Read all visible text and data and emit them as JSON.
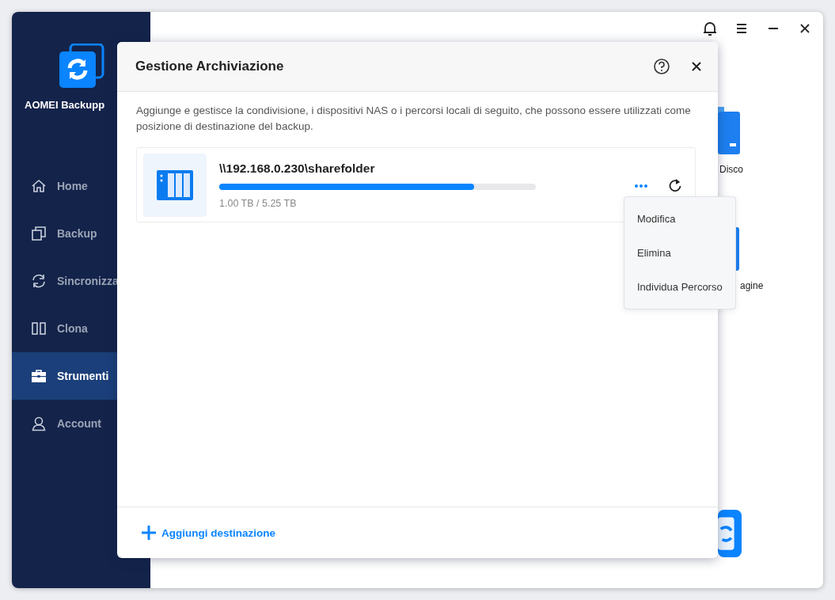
{
  "app": {
    "name": "AOMEI Backupp"
  },
  "sidebar": {
    "items": [
      {
        "label": "Home",
        "selected": false
      },
      {
        "label": "Backup",
        "selected": false
      },
      {
        "label": "Sincronizza",
        "selected": false
      },
      {
        "label": "Clona",
        "selected": false
      },
      {
        "label": "Strumenti",
        "selected": true
      },
      {
        "label": "Account",
        "selected": false
      }
    ]
  },
  "background_tiles": [
    {
      "label": "Disco",
      "kind": "disk"
    },
    {
      "label": "agine",
      "kind": "image"
    },
    {
      "kind": "logo"
    }
  ],
  "dialog": {
    "title": "Gestione Archiviazione",
    "description": "Aggiunge e gestisce la condivisione, i dispositivi NAS o i percorsi locali di seguito, che possono essere utilizzati come posizione di destinazione del backup.",
    "destinations": [
      {
        "path": "\\\\192.168.0.230\\sharefolder",
        "level": 0.805,
        "usage": "1.00 TB / 5.25 TB"
      }
    ],
    "add_button": "Aggiungi destinazione"
  },
  "context_menu": {
    "items": [
      {
        "label": "Modifica"
      },
      {
        "label": "Elimina"
      },
      {
        "label": "Individua Percorso"
      }
    ]
  }
}
